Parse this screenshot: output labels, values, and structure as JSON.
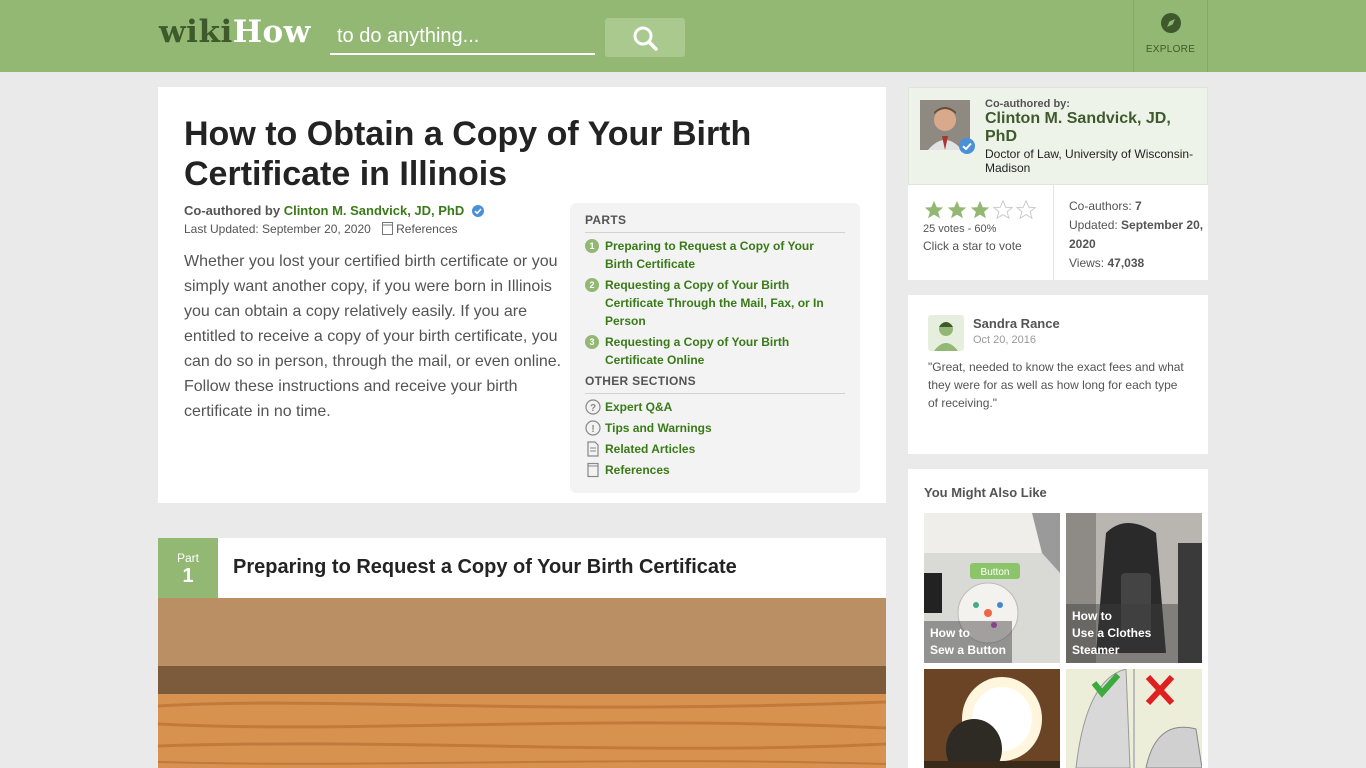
{
  "header": {
    "logo_wiki": "wiki",
    "logo_how": "How",
    "search_placeholder": "to do anything...",
    "explore_label": "EXPLORE"
  },
  "article": {
    "title": "How to Obtain a Copy of Your Birth Certificate in Illinois",
    "byline_prefix": "Co-authored by",
    "author": "Clinton M. Sandvick, JD, PhD",
    "last_updated": "Last Updated: September 20, 2020",
    "references_link": "References",
    "intro": "Whether you lost your certified birth certificate or you simply want another copy, if you were born in Illinois you can obtain a copy relatively easily. If you are entitled to receive a copy of your birth certificate, you can do so in person, through the mail, or even online. Follow these instructions and receive your birth certificate in no time."
  },
  "toc": {
    "parts_heading": "PARTS",
    "parts": [
      {
        "num": "1",
        "label": "Preparing to Request a Copy of Your Birth Certificate"
      },
      {
        "num": "2",
        "label": "Requesting a Copy of Your Birth Certificate Through the Mail, Fax, or In Person"
      },
      {
        "num": "3",
        "label": "Requesting a Copy of Your Birth Certificate Online"
      }
    ],
    "other_heading": "OTHER SECTIONS",
    "sections": [
      {
        "label": "Expert Q&A",
        "icon": "question-icon"
      },
      {
        "label": "Tips and Warnings",
        "icon": "exclamation-icon"
      },
      {
        "label": "Related Articles",
        "icon": "document-icon"
      },
      {
        "label": "References",
        "icon": "reference-icon"
      }
    ]
  },
  "part1": {
    "part_word": "Part",
    "number": "1",
    "title": "Preparing to Request a Copy of Your Birth Certificate"
  },
  "coauthor_card": {
    "label": "Co-authored by:",
    "name": "Clinton M. Sandvick, JD, PhD",
    "credential": "Doctor of Law, University of Wisconsin-Madison",
    "rating": 3,
    "rating_max": 5,
    "votes": "25 votes - 60%",
    "vote_cta": "Click a star to vote",
    "coauthors_label": "Co-authors:",
    "coauthors_value": "7",
    "updated_label": "Updated:",
    "updated_value": "September 20, 2020",
    "views_label": "Views:",
    "views_value": "47,038"
  },
  "testimonial": {
    "name": "Sandra Rance",
    "date": "Oct 20, 2016",
    "quote": "\"Great, needed to know the exact fees and what they were for as well as how long for each type of receiving.\""
  },
  "related": {
    "heading": "You Might Also Like",
    "items": [
      {
        "line1": "How to",
        "line2": "Sew a Button"
      },
      {
        "line1": "How to",
        "line2": "Use a Clothes Steamer"
      },
      {
        "line1": "",
        "line2": ""
      },
      {
        "line1": "",
        "line2": ""
      }
    ]
  },
  "colors": {
    "header_green": "#93b874",
    "link_green": "#3a7a18",
    "dark_green": "#3e5a2c"
  }
}
